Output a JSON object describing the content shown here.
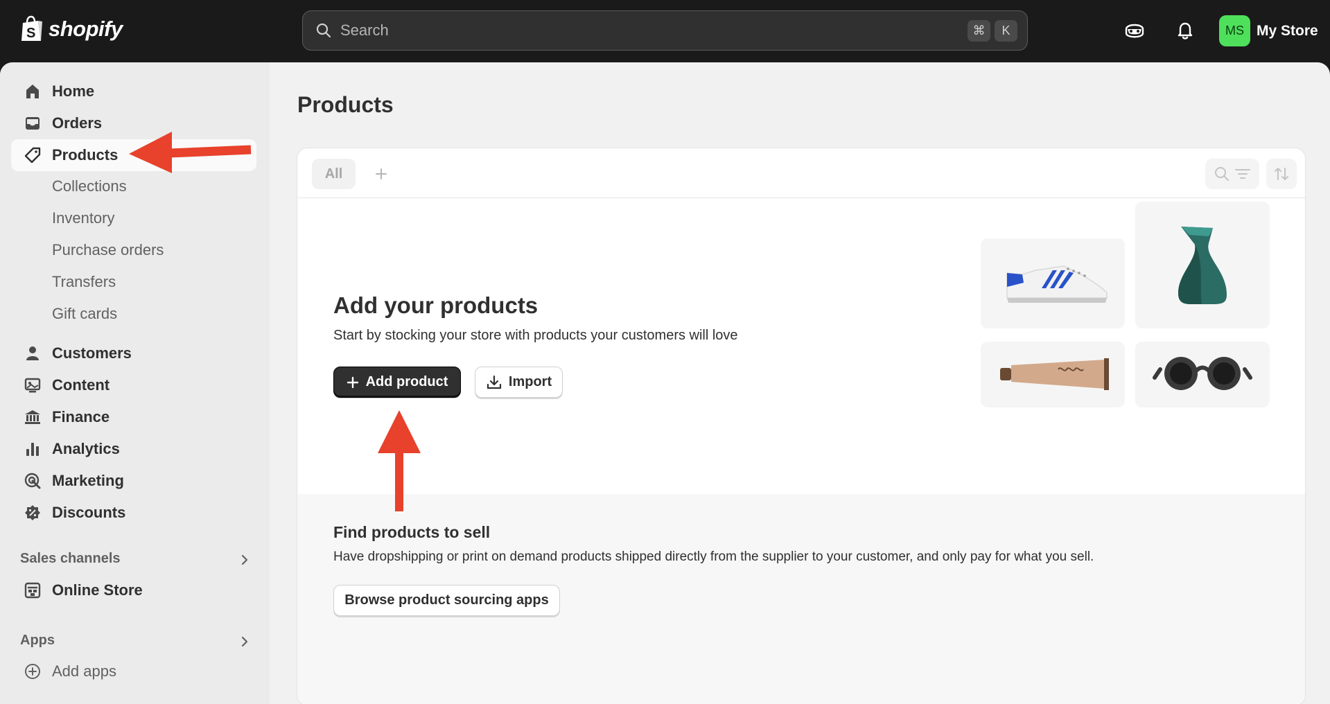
{
  "app": {
    "brand": "shopify"
  },
  "topbar": {
    "search_placeholder": "Search",
    "shortcut_keys": [
      "⌘",
      "K"
    ],
    "store": {
      "initials": "MS",
      "name": "My Store",
      "avatar_color": "#4ee05a"
    }
  },
  "sidebar": {
    "items": [
      {
        "label": "Home",
        "icon": "home-icon"
      },
      {
        "label": "Orders",
        "icon": "inbox-icon"
      },
      {
        "label": "Products",
        "icon": "tag-icon",
        "active": true
      }
    ],
    "product_sub": [
      "Collections",
      "Inventory",
      "Purchase orders",
      "Transfers",
      "Gift cards"
    ],
    "items2": [
      {
        "label": "Customers",
        "icon": "person-icon"
      },
      {
        "label": "Content",
        "icon": "content-icon"
      },
      {
        "label": "Finance",
        "icon": "bank-icon"
      },
      {
        "label": "Analytics",
        "icon": "bar-chart-icon"
      },
      {
        "label": "Marketing",
        "icon": "target-icon"
      },
      {
        "label": "Discounts",
        "icon": "discount-icon"
      }
    ],
    "sales_channels_label": "Sales channels",
    "online_store_label": "Online Store",
    "apps_label": "Apps",
    "add_apps_label": "Add apps"
  },
  "main": {
    "title": "Products",
    "tabs": {
      "all_label": "All"
    },
    "empty_state": {
      "title": "Add your products",
      "subtitle": "Start by stocking your store with products your customers will love",
      "add_product_label": "Add product",
      "import_label": "Import",
      "illustrations": [
        "sneaker",
        "vase",
        "tube",
        "sunglasses"
      ]
    },
    "sourcing": {
      "title": "Find products to sell",
      "description": "Have dropshipping or print on demand products shipped directly from the supplier to your customer, and only pay for what you sell.",
      "button_label": "Browse product sourcing apps"
    }
  },
  "colors": {
    "annotation_arrow": "#e8412c",
    "topbar": "#1a1a1a",
    "primary_button": "#303030"
  }
}
